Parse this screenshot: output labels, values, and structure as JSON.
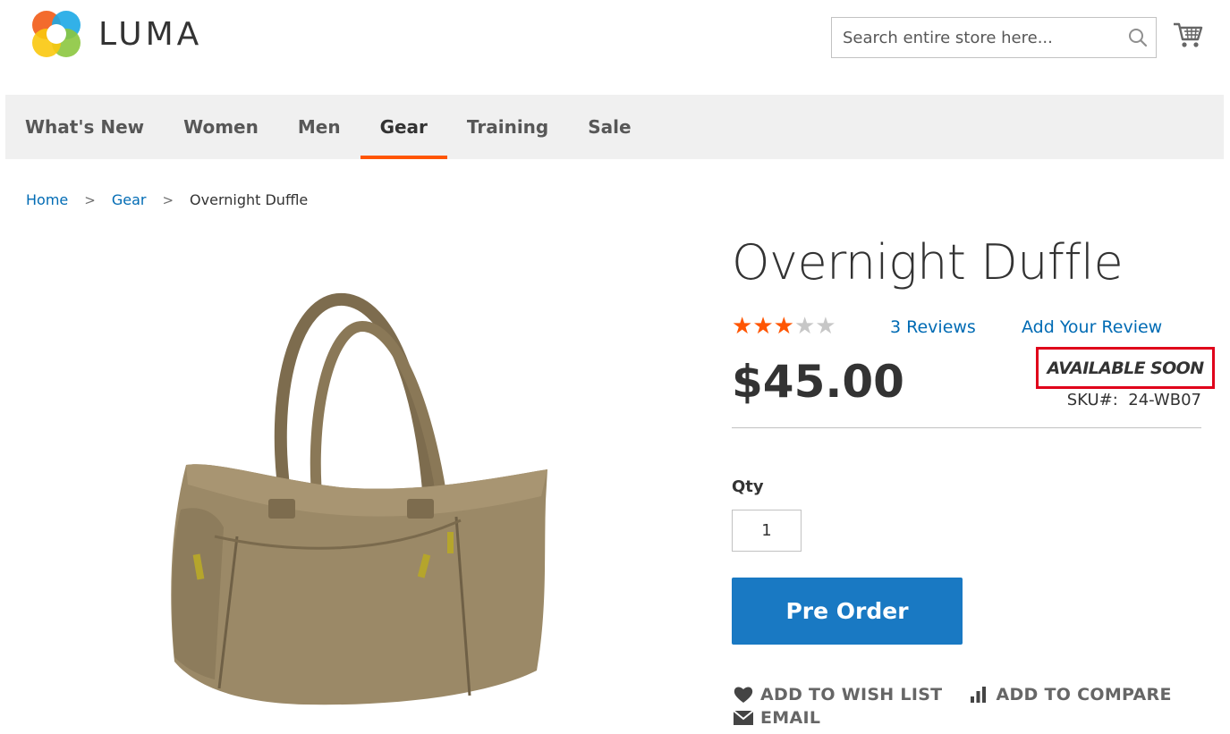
{
  "header": {
    "logo_text": "LUMA",
    "search_placeholder": "Search entire store here...",
    "icons": [
      "search-icon",
      "cart-icon"
    ]
  },
  "nav": {
    "items": [
      {
        "label": "What's New"
      },
      {
        "label": "Women"
      },
      {
        "label": "Men"
      },
      {
        "label": "Gear",
        "active": true
      },
      {
        "label": "Training"
      },
      {
        "label": "Sale"
      }
    ]
  },
  "breadcrumb": {
    "home": "Home",
    "gear": "Gear",
    "current": "Overnight Duffle"
  },
  "product": {
    "title": "Overnight Duffle",
    "rating_stars": 3,
    "rating_max": 5,
    "reviews_label": "3  Reviews",
    "add_review_label": "Add Your Review",
    "price": "$45.00",
    "stock_status": "AVAILABLE SOON",
    "sku_label": "SKU#:",
    "sku_value": "24-WB07",
    "qty_label": "Qty",
    "qty_value": "1",
    "cta_label": "Pre Order"
  },
  "actions": {
    "wishlist": "ADD TO WISH LIST",
    "compare": "ADD TO COMPARE",
    "email": "EMAIL"
  },
  "colors": {
    "accent": "#ff5501",
    "primary_button": "#1979c3",
    "link": "#006bb4",
    "highlight_border": "#e0001a"
  }
}
